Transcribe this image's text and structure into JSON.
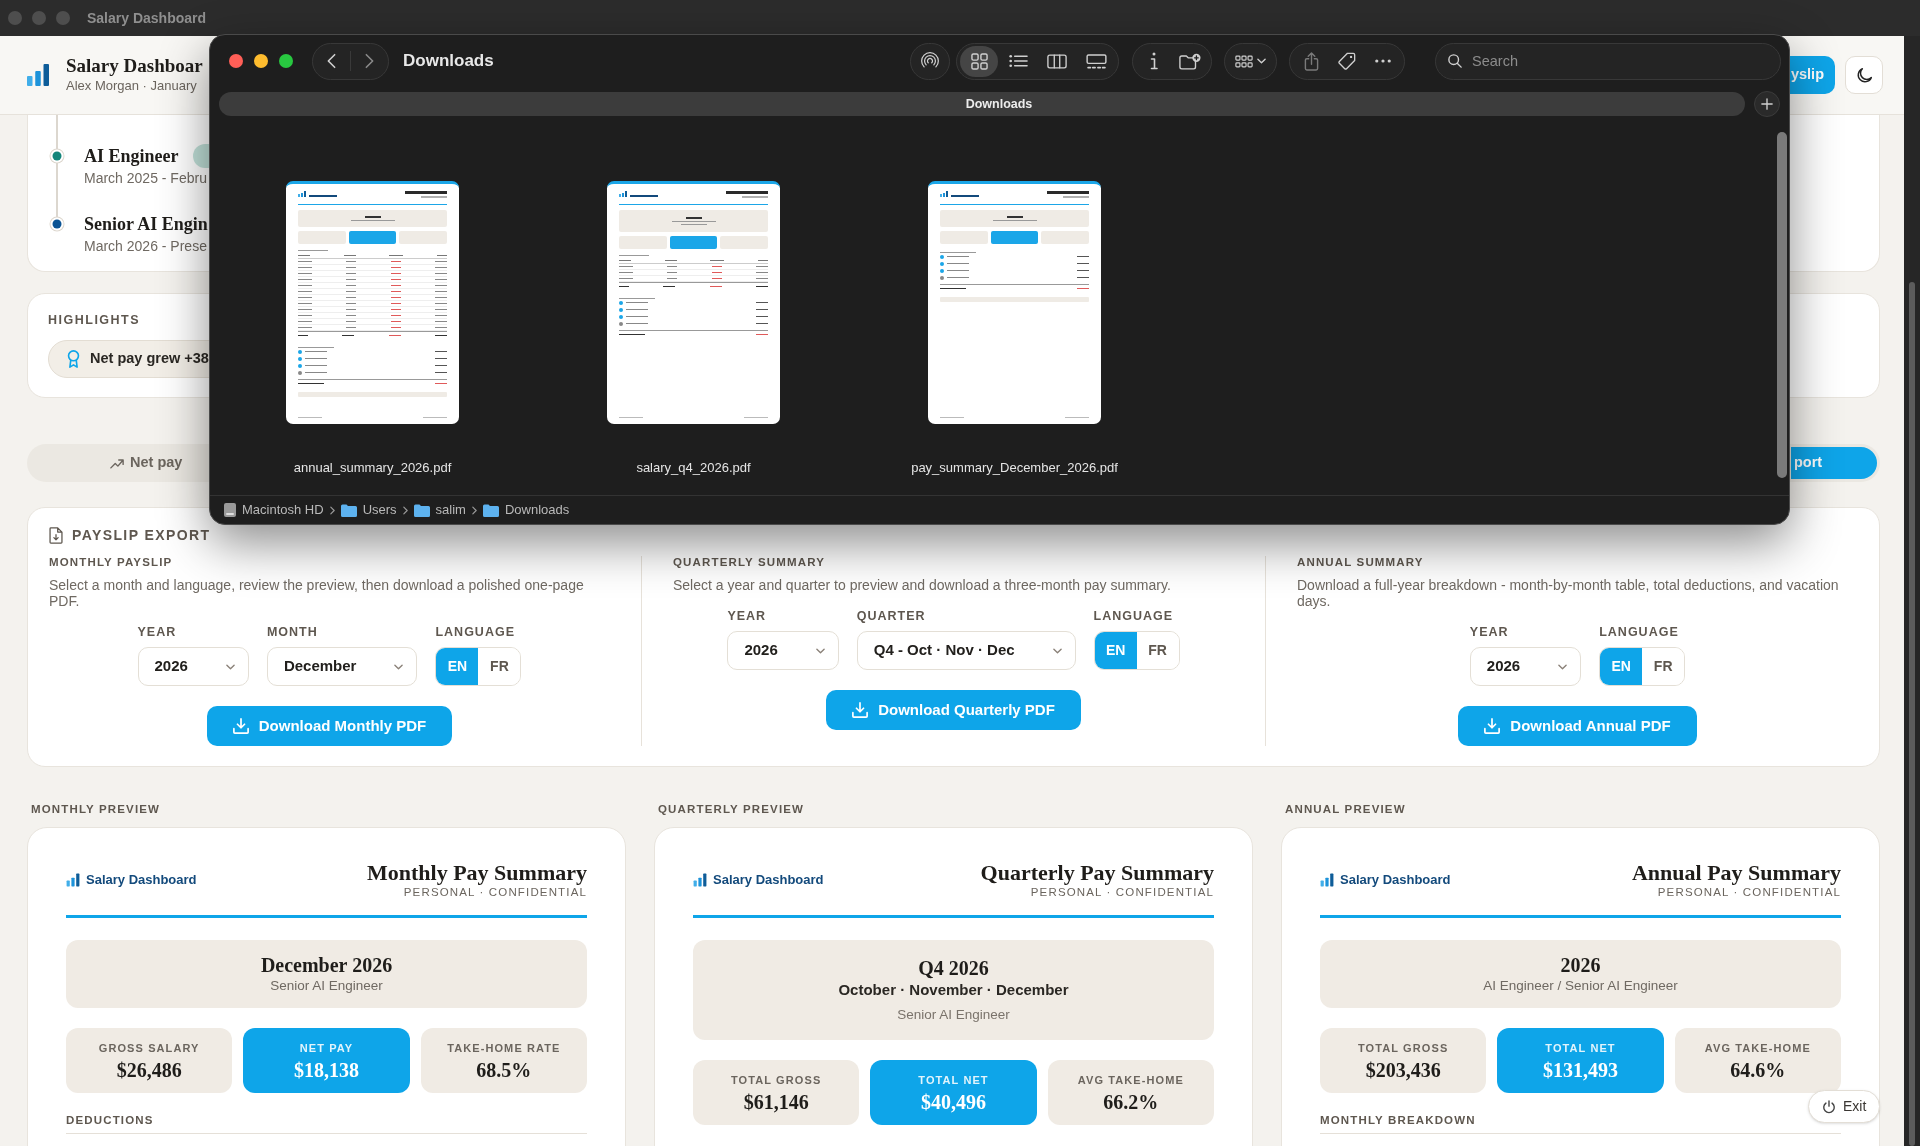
{
  "window": {
    "title": "Salary Dashboard"
  },
  "header": {
    "title": "Salary Dashboar",
    "subtitle": "Alex Morgan · January",
    "action_button": "yslip"
  },
  "finder": {
    "title": "Downloads",
    "view_modes": [
      {
        "kind": "icons",
        "selected": true
      },
      {
        "kind": "list",
        "selected": false
      },
      {
        "kind": "columns",
        "selected": false
      },
      {
        "kind": "gallery",
        "selected": false
      }
    ],
    "search": {
      "placeholder": "Search"
    },
    "tab": "Downloads",
    "files": [
      {
        "name": "annual_summary_2026.pdf",
        "kind": "annual"
      },
      {
        "name": "salary_q4_2026.pdf",
        "kind": "quarterly"
      },
      {
        "name": "pay_summary_December_2026.pdf",
        "kind": "monthly"
      }
    ],
    "path": [
      {
        "label": "Macintosh HD",
        "kind": "disk"
      },
      {
        "label": "Users",
        "kind": "folder"
      },
      {
        "label": "salim",
        "kind": "folder"
      },
      {
        "label": "Downloads",
        "kind": "folder"
      }
    ]
  },
  "timeline": [
    {
      "title": "AI Engineer",
      "dates": "March 2025 - Febru",
      "color": "#13857a",
      "badge": true
    },
    {
      "title": "Senior AI Engin",
      "dates": "March 2026 - Prese",
      "color": "#0b5394",
      "badge": false
    }
  ],
  "highlights": {
    "title": "HIGHLIGHTS",
    "items": [
      "Net pay grew +38"
    ]
  },
  "tabs": [
    {
      "kind": "trend",
      "label": "Net pay",
      "selected": false
    },
    {
      "kind": "plain",
      "label": "port",
      "selected": true
    }
  ],
  "export": {
    "title": "PAYSLIP EXPORT",
    "sections": [
      {
        "title": "MONTHLY PAYSLIP",
        "description": "Select a month and language, review the preview, then download a polished one-page PDF.",
        "fields": [
          {
            "label": "YEAR",
            "value": "2026"
          },
          {
            "label": "MONTH",
            "value": "December"
          }
        ],
        "language": {
          "label": "LANGUAGE",
          "options": [
            {
              "label": "EN",
              "selected": true
            },
            {
              "label": "FR",
              "selected": false
            }
          ]
        },
        "button": "Download Monthly PDF"
      },
      {
        "title": "QUARTERLY SUMMARY",
        "description": "Select a year and quarter to preview and download a three-month pay summary.",
        "fields": [
          {
            "label": "YEAR",
            "value": "2026"
          },
          {
            "label": "QUARTER",
            "value": "Q4 - Oct · Nov · Dec"
          }
        ],
        "language": {
          "label": "LANGUAGE",
          "options": [
            {
              "label": "EN",
              "selected": true
            },
            {
              "label": "FR",
              "selected": false
            }
          ]
        },
        "button": "Download Quarterly PDF"
      },
      {
        "title": "ANNUAL SUMMARY",
        "description": "Download a full-year breakdown - month-by-month table, total deductions, and vacation days.",
        "fields": [
          {
            "label": "YEAR",
            "value": "2026"
          }
        ],
        "language": {
          "label": "LANGUAGE",
          "options": [
            {
              "label": "EN",
              "selected": true
            },
            {
              "label": "FR",
              "selected": false
            }
          ]
        },
        "button": "Download Annual PDF"
      }
    ]
  },
  "previews": [
    {
      "label": "MONTHLY PREVIEW",
      "brand": "Salary Dashboard",
      "title": "Monthly Pay Summary",
      "subtitle": "PERSONAL · CONFIDENTIAL",
      "period": "December 2026",
      "role": "Senior AI Engineer",
      "stats": [
        {
          "label": "GROSS SALARY",
          "value": "$26,486",
          "highlighted": false
        },
        {
          "label": "NET PAY",
          "value": "$18,138",
          "highlighted": true
        },
        {
          "label": "TAKE-HOME RATE",
          "value": "68.5%",
          "highlighted": false
        }
      ],
      "section": "DEDUCTIONS"
    },
    {
      "label": "QUARTERLY PREVIEW",
      "brand": "Salary Dashboard",
      "title": "Quarterly Pay Summary",
      "subtitle": "PERSONAL · CONFIDENTIAL",
      "period": "Q4 2026",
      "months": "October · November · December",
      "role": "Senior AI Engineer",
      "stats": [
        {
          "label": "TOTAL GROSS",
          "value": "$61,146",
          "highlighted": false
        },
        {
          "label": "TOTAL NET",
          "value": "$40,496",
          "highlighted": true
        },
        {
          "label": "AVG TAKE-HOME",
          "value": "66.2%",
          "highlighted": false
        }
      ]
    },
    {
      "label": "ANNUAL PREVIEW",
      "brand": "Salary Dashboard",
      "title": "Annual Pay Summary",
      "subtitle": "PERSONAL · CONFIDENTIAL",
      "period": "2026",
      "role": "AI Engineer / Senior AI Engineer",
      "stats": [
        {
          "label": "TOTAL GROSS",
          "value": "$203,436",
          "highlighted": false
        },
        {
          "label": "TOTAL NET",
          "value": "$131,493",
          "highlighted": true
        },
        {
          "label": "AVG TAKE-HOME",
          "value": "64.6%",
          "highlighted": false
        }
      ],
      "section": "MONTHLY BREAKDOWN"
    }
  ],
  "exit_button": "Exit"
}
